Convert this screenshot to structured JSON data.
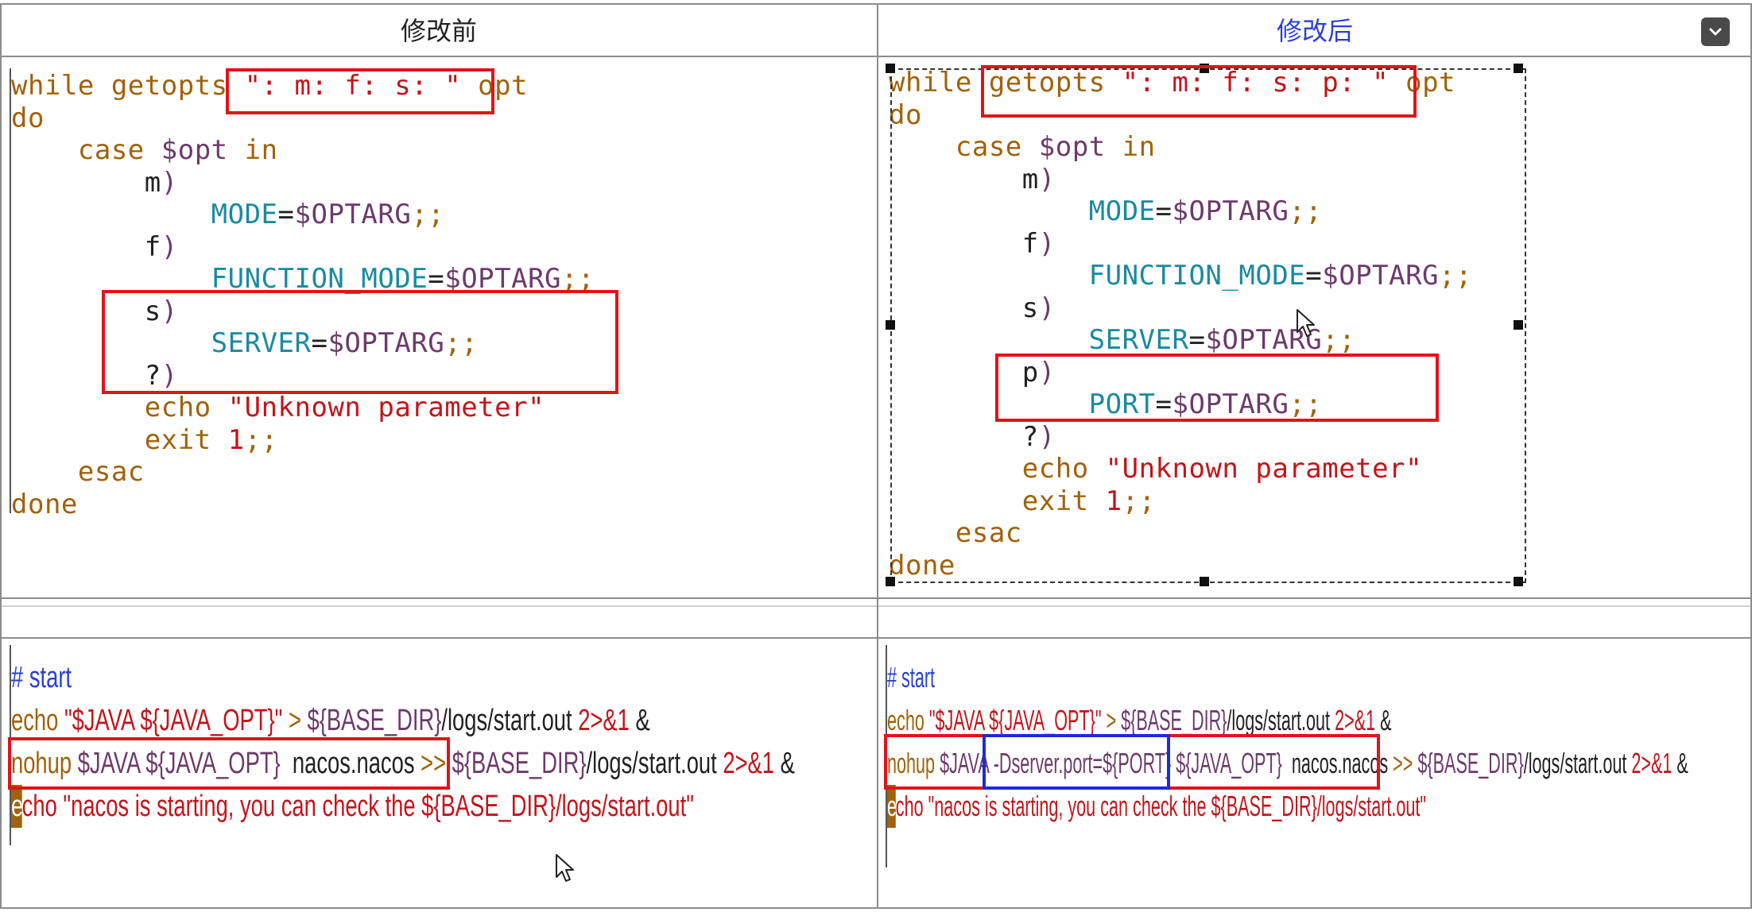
{
  "headers": {
    "before": "修改前",
    "after": "修改后"
  },
  "left_script": {
    "lines": [
      [
        [
          "k",
          "while getopts "
        ],
        [
          "r",
          "\": m: f: s: \""
        ],
        [
          "d",
          " "
        ],
        [
          "k",
          "opt"
        ]
      ],
      [
        [
          "k",
          "do"
        ]
      ],
      [
        [
          "d",
          "    "
        ],
        [
          "k",
          "case "
        ],
        [
          "p",
          "$opt "
        ],
        [
          "k",
          "in"
        ]
      ],
      [
        [
          "d",
          "        "
        ],
        [
          "d",
          "m"
        ],
        [
          "p",
          ")"
        ]
      ],
      [
        [
          "d",
          "            "
        ],
        [
          "t",
          "MODE"
        ],
        [
          "d",
          "="
        ],
        [
          "p",
          "$OPTARG"
        ],
        [
          "k",
          ";;"
        ]
      ],
      [
        [
          "d",
          "        "
        ],
        [
          "d",
          "f"
        ],
        [
          "p",
          ")"
        ]
      ],
      [
        [
          "d",
          "            "
        ],
        [
          "t",
          "FUNCTION_MODE"
        ],
        [
          "d",
          "="
        ],
        [
          "p",
          "$OPTARG"
        ],
        [
          "k",
          ";;"
        ]
      ],
      [
        [
          "d",
          "        "
        ],
        [
          "d",
          "s"
        ],
        [
          "p",
          ")"
        ]
      ],
      [
        [
          "d",
          "            "
        ],
        [
          "t",
          "SERVER"
        ],
        [
          "d",
          "="
        ],
        [
          "p",
          "$OPTARG"
        ],
        [
          "k",
          ";;"
        ]
      ],
      [
        [
          "d",
          "        "
        ],
        [
          "d",
          "?"
        ],
        [
          "p",
          ")"
        ]
      ],
      [
        [
          "d",
          "        "
        ],
        [
          "k",
          "echo "
        ],
        [
          "r",
          "\"Unknown parameter\""
        ]
      ],
      [
        [
          "d",
          "        "
        ],
        [
          "k",
          "exit "
        ],
        [
          "r",
          "1"
        ],
        [
          "k",
          ";;"
        ]
      ],
      [
        [
          "d",
          "    "
        ],
        [
          "k",
          "esac"
        ]
      ],
      [
        [
          "k",
          "done"
        ]
      ]
    ]
  },
  "right_script": {
    "lines": [
      [
        [
          "k",
          "while "
        ],
        [
          "k",
          "getopts "
        ],
        [
          "r",
          "\": m: f: s: p: \""
        ],
        [
          "d",
          " "
        ],
        [
          "k",
          "opt"
        ]
      ],
      [
        [
          "k",
          "do"
        ]
      ],
      [
        [
          "d",
          "    "
        ],
        [
          "k",
          "case "
        ],
        [
          "p",
          "$opt "
        ],
        [
          "k",
          "in"
        ]
      ],
      [
        [
          "d",
          "        "
        ],
        [
          "d",
          "m"
        ],
        [
          "p",
          ")"
        ]
      ],
      [
        [
          "d",
          "            "
        ],
        [
          "t",
          "MODE"
        ],
        [
          "d",
          "="
        ],
        [
          "p",
          "$OPTARG"
        ],
        [
          "k",
          ";;"
        ]
      ],
      [
        [
          "d",
          "        "
        ],
        [
          "d",
          "f"
        ],
        [
          "p",
          ")"
        ]
      ],
      [
        [
          "d",
          "            "
        ],
        [
          "t",
          "FUNCTION_MODE"
        ],
        [
          "d",
          "="
        ],
        [
          "p",
          "$OPTARG"
        ],
        [
          "k",
          ";;"
        ]
      ],
      [
        [
          "d",
          "        "
        ],
        [
          "d",
          "s"
        ],
        [
          "p",
          ")"
        ]
      ],
      [
        [
          "d",
          "            "
        ],
        [
          "t",
          "SERVER"
        ],
        [
          "d",
          "="
        ],
        [
          "p",
          "$OPTARG"
        ],
        [
          "k",
          ";;"
        ]
      ],
      [
        [
          "d",
          "        "
        ],
        [
          "d",
          "p"
        ],
        [
          "p",
          ")"
        ]
      ],
      [
        [
          "d",
          "            "
        ],
        [
          "t",
          "PORT"
        ],
        [
          "d",
          "="
        ],
        [
          "p",
          "$OPTARG"
        ],
        [
          "k",
          ";;"
        ]
      ],
      [
        [
          "d",
          "        "
        ],
        [
          "d",
          "?"
        ],
        [
          "p",
          ")"
        ]
      ],
      [
        [
          "d",
          "        "
        ],
        [
          "k",
          "echo "
        ],
        [
          "r",
          "\"Unknown parameter\""
        ]
      ],
      [
        [
          "d",
          "        "
        ],
        [
          "k",
          "exit "
        ],
        [
          "r",
          "1"
        ],
        [
          "k",
          ";;"
        ]
      ],
      [
        [
          "d",
          "    "
        ],
        [
          "k",
          "esac"
        ]
      ],
      [
        [
          "k",
          "done"
        ]
      ]
    ]
  },
  "left_start": {
    "lines": [
      [
        [
          "blue",
          "# start"
        ]
      ],
      [
        [
          "k",
          "echo "
        ],
        [
          "r",
          "\"$JAVA ${JAVA_OPT}\""
        ],
        [
          "k",
          " > "
        ],
        [
          "p",
          "${BASE_DIR}"
        ],
        [
          "d",
          "/logs/start.out "
        ],
        [
          "r",
          "2>&1"
        ],
        [
          "d",
          " &"
        ]
      ],
      [
        [
          "k",
          "nohup "
        ],
        [
          "p",
          "$JAVA ${JAVA_OPT} "
        ],
        [
          "d",
          " nacos.nacos "
        ],
        [
          "k",
          ">> "
        ],
        [
          "p",
          "${BASE_DIR}"
        ],
        [
          "d",
          "/logs/start.out "
        ],
        [
          "r",
          "2>&1"
        ],
        [
          "d",
          " &"
        ]
      ],
      [
        [
          "cur",
          "e"
        ],
        [
          "r",
          "cho \"nacos is starting, you can check the ${BASE_DIR}/logs/start.out\""
        ]
      ]
    ]
  },
  "right_start": {
    "lines": [
      [
        [
          "blue",
          "# start"
        ]
      ],
      [
        [
          "k",
          "echo "
        ],
        [
          "r",
          "\"$JAVA ${JAVA_OPT}\""
        ],
        [
          "k",
          " > "
        ],
        [
          "p",
          "${BASE_DIR}"
        ],
        [
          "d",
          "/logs/start.out "
        ],
        [
          "r",
          "2>&1"
        ],
        [
          "d",
          " &"
        ]
      ],
      [
        [
          "k",
          "nohup "
        ],
        [
          "p",
          "$JAVA "
        ],
        [
          "p",
          "-Dserver.port=${PORT} "
        ],
        [
          "p",
          "${JAVA_OPT} "
        ],
        [
          "d",
          " nacos.nacos "
        ],
        [
          "k",
          ">> "
        ],
        [
          "p",
          "${BASE_DIR}"
        ],
        [
          "d",
          "/logs/start.out "
        ],
        [
          "r",
          "2>&1"
        ],
        [
          "d",
          " &"
        ]
      ],
      [
        [
          "cur",
          "e"
        ],
        [
          "r",
          "cho \"nacos is starting, you can check the ${BASE_DIR}/logs/start.out\""
        ]
      ]
    ]
  },
  "icons": {
    "dropdown": "chevron-down-icon",
    "pointer": "mouse-pointer-icon"
  },
  "colors": {
    "highlight_red": "#e0141a",
    "highlight_blue": "#1d2bd9",
    "header_after": "#2b3fd6"
  }
}
